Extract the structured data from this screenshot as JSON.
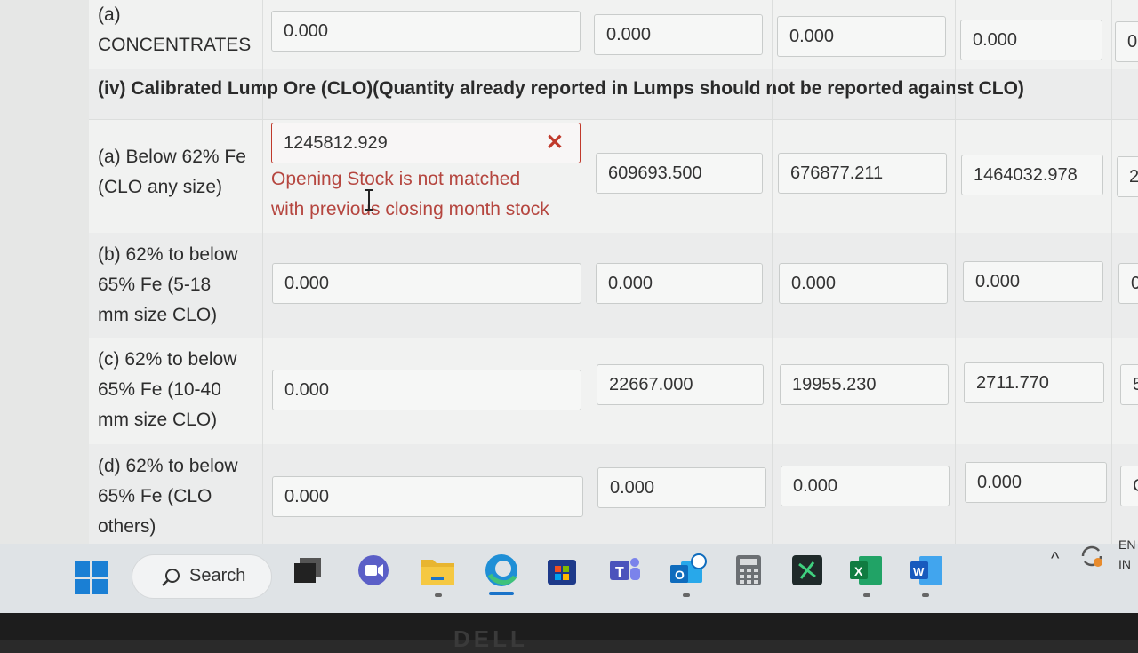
{
  "rows": {
    "concentrates": {
      "label_line1": "(a)",
      "label_line2": "CONCENTRATES",
      "values": [
        "0.000",
        "0.000",
        "0.000",
        "0.000",
        "0."
      ]
    },
    "section_iv_title": "(iv) Calibrated Lump Ore (CLO)(Quantity already reported in Lumps should not be reported against CLO)",
    "clo_a": {
      "label_line1": "(a) Below 62% Fe",
      "label_line2": "(CLO any size)",
      "input_value": "1245812.929",
      "error_line1": "Opening Stock is not matched",
      "error_line2": "with previous closing month stock",
      "values": [
        "609693.500",
        "676877.211",
        "1464032.978",
        "2"
      ]
    },
    "clo_b": {
      "label_line1": "(b) 62% to below",
      "label_line2": "65% Fe (5-18",
      "label_line3": "mm size CLO)",
      "values": [
        "0.000",
        "0.000",
        "0.000",
        "0.000",
        "0"
      ]
    },
    "clo_c": {
      "label_line1": "(c) 62% to below",
      "label_line2": "65% Fe (10-40",
      "label_line3": "mm size CLO)",
      "values": [
        "0.000",
        "22667.000",
        "19955.230",
        "2711.770",
        "5"
      ]
    },
    "clo_d": {
      "label_line1": "(d) 62% to below",
      "label_line2": "65% Fe (CLO",
      "label_line3": "others)",
      "values": [
        "0.000",
        "0.000",
        "0.000",
        "0.000",
        "C"
      ]
    }
  },
  "taskbar": {
    "search_label": "Search",
    "lang_line1": "EN",
    "lang_line2": "IN"
  },
  "bezel_brand": "DELL",
  "colors": {
    "error": "#c0392b",
    "accent": "#1a7fd4"
  }
}
